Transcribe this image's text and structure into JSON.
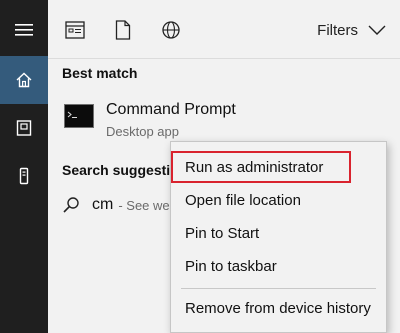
{
  "sidebar": {
    "items": [
      {
        "icon": "hamburger-menu-icon"
      },
      {
        "icon": "home-icon"
      },
      {
        "icon": "document-box-icon"
      },
      {
        "icon": "tower-pc-icon"
      }
    ]
  },
  "toolbar": {
    "icons": [
      "apps-icon",
      "documents-icon",
      "web-globe-icon"
    ],
    "filters_label": "Filters"
  },
  "best_match": {
    "title": "Best match",
    "app_name": "Command Prompt",
    "app_type": "Desktop app"
  },
  "suggestions": {
    "title": "Search suggestion",
    "query": "cm",
    "hint": "- See web"
  },
  "context_menu": {
    "items": [
      "Run as administrator",
      "Open file location",
      "Pin to Start",
      "Pin to taskbar",
      "Remove from device history"
    ],
    "highlighted_item": "Run as administrator",
    "highlight_color": "#d9232e"
  },
  "colors": {
    "sidebar_bg": "#1f1f1f",
    "sidebar_active": "#345b7c",
    "panel_bg": "#f2f2f2"
  }
}
